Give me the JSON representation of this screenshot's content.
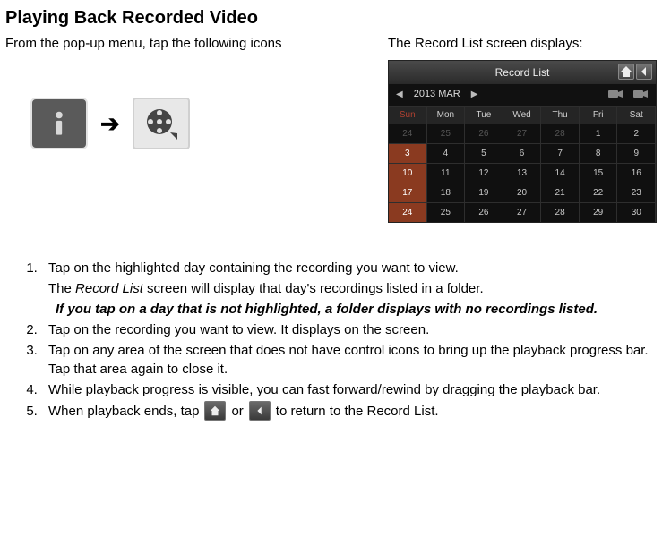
{
  "title": "Playing Back Recorded Video",
  "leftIntro": "From the pop-up menu, tap the following icons",
  "rightIntro": "The Record List screen displays:",
  "arrowGlyph": "➔",
  "recordList": {
    "title": "Record List",
    "month": "2013 MAR",
    "weekdays": [
      "Sun",
      "Mon",
      "Tue",
      "Wed",
      "Thu",
      "Fri",
      "Sat"
    ],
    "rows": [
      {
        "cells": [
          {
            "v": "24",
            "cls": "dim sun-date"
          },
          {
            "v": "25",
            "cls": "dim"
          },
          {
            "v": "26",
            "cls": "dim"
          },
          {
            "v": "27",
            "cls": "dim"
          },
          {
            "v": "28",
            "cls": "dim"
          },
          {
            "v": "1"
          },
          {
            "v": "2"
          }
        ]
      },
      {
        "cells": [
          {
            "v": "3",
            "cls": "hl"
          },
          {
            "v": "4"
          },
          {
            "v": "5"
          },
          {
            "v": "6"
          },
          {
            "v": "7"
          },
          {
            "v": "8"
          },
          {
            "v": "9"
          }
        ]
      },
      {
        "cells": [
          {
            "v": "10",
            "cls": "hl"
          },
          {
            "v": "11"
          },
          {
            "v": "12"
          },
          {
            "v": "13"
          },
          {
            "v": "14"
          },
          {
            "v": "15"
          },
          {
            "v": "16"
          }
        ]
      },
      {
        "cells": [
          {
            "v": "17",
            "cls": "hl"
          },
          {
            "v": "18"
          },
          {
            "v": "19"
          },
          {
            "v": "20"
          },
          {
            "v": "21"
          },
          {
            "v": "22"
          },
          {
            "v": "23"
          }
        ]
      },
      {
        "cells": [
          {
            "v": "24",
            "cls": "hl"
          },
          {
            "v": "25"
          },
          {
            "v": "26"
          },
          {
            "v": "27"
          },
          {
            "v": "28"
          },
          {
            "v": "29"
          },
          {
            "v": "30"
          }
        ]
      }
    ]
  },
  "steps": {
    "s1a": "Tap on the highlighted day containing the recording you want to view.",
    "s1b_pre": "The ",
    "s1b_em": "Record List",
    "s1b_post": " screen will display that day's recordings listed in a folder.",
    "s1note": "If you tap on a day that is not highlighted, a folder displays with no recordings listed.",
    "s2": "Tap on the recording you want to view. It displays on the screen.",
    "s3": "Tap on any area of the screen that does not have control icons to bring up the playback progress bar. Tap that area again to close it.",
    "s4": "While playback progress is visible, you can fast forward/rewind by dragging the playback bar.",
    "s5a": "When playback ends, tap",
    "s5or": "or",
    "s5b": "to return to the Record List."
  }
}
